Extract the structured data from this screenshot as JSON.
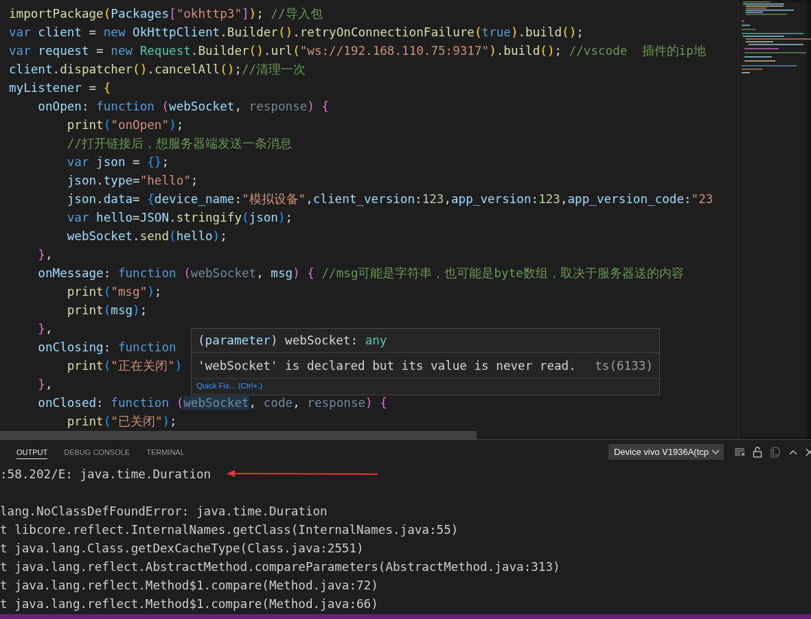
{
  "editor": {
    "lines": [
      {
        "tokens": [
          {
            "text": "importPackage",
            "kind": "func"
          },
          {
            "text": "(",
            "kind": "bracket1"
          },
          {
            "text": "Packages",
            "kind": "var"
          },
          {
            "text": "[",
            "kind": "bracket2"
          },
          {
            "text": "\"okhttp3\"",
            "kind": "string"
          },
          {
            "text": "]",
            "kind": "bracket2"
          },
          {
            "text": ")",
            "kind": "bracket1"
          },
          {
            "text": ";",
            "kind": "plain"
          },
          {
            "text": " //导入包",
            "kind": "comment"
          }
        ]
      },
      {
        "tokens": [
          {
            "text": "var",
            "kind": "keyword"
          },
          {
            "text": " client",
            "kind": "var"
          },
          {
            "text": " = ",
            "kind": "plain"
          },
          {
            "text": "new",
            "kind": "keyword"
          },
          {
            "text": " OkHttpClient",
            "kind": "var"
          },
          {
            "text": ".",
            "kind": "plain"
          },
          {
            "text": "Builder",
            "kind": "func"
          },
          {
            "text": "()",
            "kind": "bracket1"
          },
          {
            "text": ".",
            "kind": "plain"
          },
          {
            "text": "retryOnConnectionFailure",
            "kind": "func"
          },
          {
            "text": "(",
            "kind": "bracket1"
          },
          {
            "text": "true",
            "kind": "keyword"
          },
          {
            "text": ")",
            "kind": "bracket1"
          },
          {
            "text": ".",
            "kind": "plain"
          },
          {
            "text": "build",
            "kind": "func"
          },
          {
            "text": "()",
            "kind": "bracket1"
          },
          {
            "text": ";",
            "kind": "plain"
          }
        ]
      },
      {
        "tokens": [
          {
            "text": "var",
            "kind": "keyword"
          },
          {
            "text": " request",
            "kind": "var"
          },
          {
            "text": " = ",
            "kind": "plain"
          },
          {
            "text": "new",
            "kind": "keyword"
          },
          {
            "text": " Request",
            "kind": "class"
          },
          {
            "text": ".",
            "kind": "plain"
          },
          {
            "text": "Builder",
            "kind": "func"
          },
          {
            "text": "()",
            "kind": "bracket1"
          },
          {
            "text": ".",
            "kind": "plain"
          },
          {
            "text": "url",
            "kind": "func"
          },
          {
            "text": "(",
            "kind": "bracket1"
          },
          {
            "text": "\"ws://192.168.110.75:9317\"",
            "kind": "string"
          },
          {
            "text": ")",
            "kind": "bracket1"
          },
          {
            "text": ".",
            "kind": "plain"
          },
          {
            "text": "build",
            "kind": "func"
          },
          {
            "text": "()",
            "kind": "bracket1"
          },
          {
            "text": ";",
            "kind": "plain"
          },
          {
            "text": " //vscode  插件的ip地",
            "kind": "comment"
          }
        ]
      },
      {
        "tokens": [
          {
            "text": "client",
            "kind": "var"
          },
          {
            "text": ".",
            "kind": "plain"
          },
          {
            "text": "dispatcher",
            "kind": "func"
          },
          {
            "text": "()",
            "kind": "bracket1"
          },
          {
            "text": ".",
            "kind": "plain"
          },
          {
            "text": "cancelAll",
            "kind": "func"
          },
          {
            "text": "()",
            "kind": "bracket1"
          },
          {
            "text": ";",
            "kind": "plain"
          },
          {
            "text": "//清理一次",
            "kind": "comment"
          }
        ]
      },
      {
        "tokens": [
          {
            "text": "myListener",
            "kind": "var"
          },
          {
            "text": " = ",
            "kind": "plain"
          },
          {
            "text": "{",
            "kind": "bracket1"
          }
        ]
      },
      {
        "tokens": [
          {
            "text": "    onOpen",
            "kind": "var"
          },
          {
            "text": ": ",
            "kind": "plain"
          },
          {
            "text": "function",
            "kind": "keyword"
          },
          {
            "text": " (",
            "kind": "bracket2"
          },
          {
            "text": "webSocket",
            "kind": "var"
          },
          {
            "text": ", ",
            "kind": "plain"
          },
          {
            "text": "response",
            "kind": "unused"
          },
          {
            "text": ")",
            "kind": "bracket2"
          },
          {
            "text": " {",
            "kind": "bracket2"
          }
        ]
      },
      {
        "tokens": [
          {
            "text": "        print",
            "kind": "func"
          },
          {
            "text": "(",
            "kind": "bracket3"
          },
          {
            "text": "\"onOpen\"",
            "kind": "string"
          },
          {
            "text": ")",
            "kind": "bracket3"
          },
          {
            "text": ";",
            "kind": "plain"
          }
        ]
      },
      {
        "tokens": [
          {
            "text": "        //打开链接后，想服务器端发送一条消息",
            "kind": "comment"
          }
        ]
      },
      {
        "tokens": [
          {
            "text": "        var",
            "kind": "keyword"
          },
          {
            "text": " json",
            "kind": "var"
          },
          {
            "text": " = ",
            "kind": "plain"
          },
          {
            "text": "{}",
            "kind": "bracket3"
          },
          {
            "text": ";",
            "kind": "plain"
          }
        ]
      },
      {
        "tokens": [
          {
            "text": "        json",
            "kind": "var"
          },
          {
            "text": ".",
            "kind": "plain"
          },
          {
            "text": "type",
            "kind": "var"
          },
          {
            "text": "=",
            "kind": "plain"
          },
          {
            "text": "\"hello\"",
            "kind": "string"
          },
          {
            "text": ";",
            "kind": "plain"
          }
        ]
      },
      {
        "tokens": [
          {
            "text": "        json",
            "kind": "var"
          },
          {
            "text": ".",
            "kind": "plain"
          },
          {
            "text": "data",
            "kind": "var"
          },
          {
            "text": "= ",
            "kind": "plain"
          },
          {
            "text": "{",
            "kind": "bracket3"
          },
          {
            "text": "device_name",
            "kind": "var"
          },
          {
            "text": ":",
            "kind": "plain"
          },
          {
            "text": "\"模拟设备\"",
            "kind": "string"
          },
          {
            "text": ",",
            "kind": "plain"
          },
          {
            "text": "client_version",
            "kind": "var"
          },
          {
            "text": ":",
            "kind": "plain"
          },
          {
            "text": "123",
            "kind": "number"
          },
          {
            "text": ",",
            "kind": "plain"
          },
          {
            "text": "app_version",
            "kind": "var"
          },
          {
            "text": ":",
            "kind": "plain"
          },
          {
            "text": "123",
            "kind": "number"
          },
          {
            "text": ",",
            "kind": "plain"
          },
          {
            "text": "app_version_code",
            "kind": "var"
          },
          {
            "text": ":",
            "kind": "plain"
          },
          {
            "text": "\"23",
            "kind": "string"
          }
        ]
      },
      {
        "tokens": [
          {
            "text": "        var",
            "kind": "keyword"
          },
          {
            "text": " hello",
            "kind": "var"
          },
          {
            "text": "=",
            "kind": "plain"
          },
          {
            "text": "JSON",
            "kind": "var"
          },
          {
            "text": ".",
            "kind": "plain"
          },
          {
            "text": "stringify",
            "kind": "func"
          },
          {
            "text": "(",
            "kind": "bracket3"
          },
          {
            "text": "json",
            "kind": "var"
          },
          {
            "text": ")",
            "kind": "bracket3"
          },
          {
            "text": ";",
            "kind": "plain"
          }
        ]
      },
      {
        "tokens": [
          {
            "text": "        webSocket",
            "kind": "var"
          },
          {
            "text": ".",
            "kind": "plain"
          },
          {
            "text": "send",
            "kind": "func"
          },
          {
            "text": "(",
            "kind": "bracket3"
          },
          {
            "text": "hello",
            "kind": "var"
          },
          {
            "text": ")",
            "kind": "bracket3"
          },
          {
            "text": ";",
            "kind": "plain"
          }
        ]
      },
      {
        "tokens": [
          {
            "text": "    }",
            "kind": "bracket2"
          },
          {
            "text": ",",
            "kind": "plain"
          }
        ]
      },
      {
        "tokens": [
          {
            "text": "    onMessage",
            "kind": "var"
          },
          {
            "text": ": ",
            "kind": "plain"
          },
          {
            "text": "function",
            "kind": "keyword"
          },
          {
            "text": " (",
            "kind": "bracket2"
          },
          {
            "text": "webSocket",
            "kind": "unused"
          },
          {
            "text": ", ",
            "kind": "plain"
          },
          {
            "text": "msg",
            "kind": "var"
          },
          {
            "text": ")",
            "kind": "bracket2"
          },
          {
            "text": " {",
            "kind": "bracket2"
          },
          {
            "text": " //msg可能是字符串，也可能是byte数组，取决于服务器送的内容",
            "kind": "comment"
          }
        ]
      },
      {
        "tokens": [
          {
            "text": "        print",
            "kind": "func"
          },
          {
            "text": "(",
            "kind": "bracket3"
          },
          {
            "text": "\"msg\"",
            "kind": "string"
          },
          {
            "text": ")",
            "kind": "bracket3"
          },
          {
            "text": ";",
            "kind": "plain"
          }
        ]
      },
      {
        "tokens": [
          {
            "text": "        print",
            "kind": "func"
          },
          {
            "text": "(",
            "kind": "bracket3"
          },
          {
            "text": "msg",
            "kind": "var"
          },
          {
            "text": ")",
            "kind": "bracket3"
          },
          {
            "text": ";",
            "kind": "plain"
          }
        ]
      },
      {
        "tokens": [
          {
            "text": "    }",
            "kind": "bracket2"
          },
          {
            "text": ",",
            "kind": "plain"
          }
        ]
      },
      {
        "tokens": [
          {
            "text": "    onClosing",
            "kind": "var"
          },
          {
            "text": ": ",
            "kind": "plain"
          },
          {
            "text": "function",
            "kind": "keyword"
          }
        ]
      },
      {
        "tokens": [
          {
            "text": "        print",
            "kind": "func"
          },
          {
            "text": "(",
            "kind": "bracket3"
          },
          {
            "text": "\"正在关闭\"",
            "kind": "string"
          },
          {
            "text": ")",
            "kind": "bracket3"
          }
        ]
      },
      {
        "tokens": [
          {
            "text": "    }",
            "kind": "bracket2"
          },
          {
            "text": ",",
            "kind": "plain"
          }
        ]
      },
      {
        "tokens": [
          {
            "text": "    onClosed",
            "kind": "var"
          },
          {
            "text": ": ",
            "kind": "plain"
          },
          {
            "text": "function",
            "kind": "keyword"
          },
          {
            "text": " (",
            "kind": "bracket2"
          },
          {
            "text": "webSocket",
            "kind": "hovered"
          },
          {
            "text": ", ",
            "kind": "plain"
          },
          {
            "text": "code",
            "kind": "unused"
          },
          {
            "text": ", ",
            "kind": "plain"
          },
          {
            "text": "response",
            "kind": "unused"
          },
          {
            "text": ")",
            "kind": "bracket2"
          },
          {
            "text": " {",
            "kind": "bracket2"
          }
        ]
      },
      {
        "tokens": [
          {
            "text": "        print",
            "kind": "func"
          },
          {
            "text": "(",
            "kind": "bracket3"
          },
          {
            "text": "\"已关闭\"",
            "kind": "string"
          },
          {
            "text": ")",
            "kind": "bracket3"
          },
          {
            "text": ";",
            "kind": "plain"
          }
        ]
      }
    ]
  },
  "hover": {
    "signature": [
      {
        "text": "(",
        "kind": "plain"
      },
      {
        "text": "parameter",
        "kind": "var"
      },
      {
        "text": ") webSocket: ",
        "kind": "plain"
      },
      {
        "text": "any",
        "kind": "class"
      }
    ],
    "message": "'webSocket' is declared but its value is never read.",
    "code": "ts(6133)",
    "action": "Quick Fix... (Ctrl+.)"
  },
  "panel": {
    "tabs": [
      {
        "label": "OUTPUT",
        "selected": true
      },
      {
        "label": "DEBUG CONSOLE",
        "selected": false
      },
      {
        "label": "TERMINAL",
        "selected": false
      }
    ],
    "channel": "Device vivo V1936A(tcp",
    "lines": [
      ":58.202/E: java.time.Duration",
      "lang.NoClassDefFoundError: java.time.Duration",
      "t libcore.reflect.InternalNames.getClass(InternalNames.java:55)",
      "t java.lang.Class.getDexCacheType(Class.java:2551)",
      "t java.lang.reflect.AbstractMethod.compareParameters(AbstractMethod.java:313)",
      "t java.lang.reflect.Method$1.compare(Method.java:72)",
      "t java.lang.reflect.Method$1.compare(Method.java:66)"
    ]
  }
}
